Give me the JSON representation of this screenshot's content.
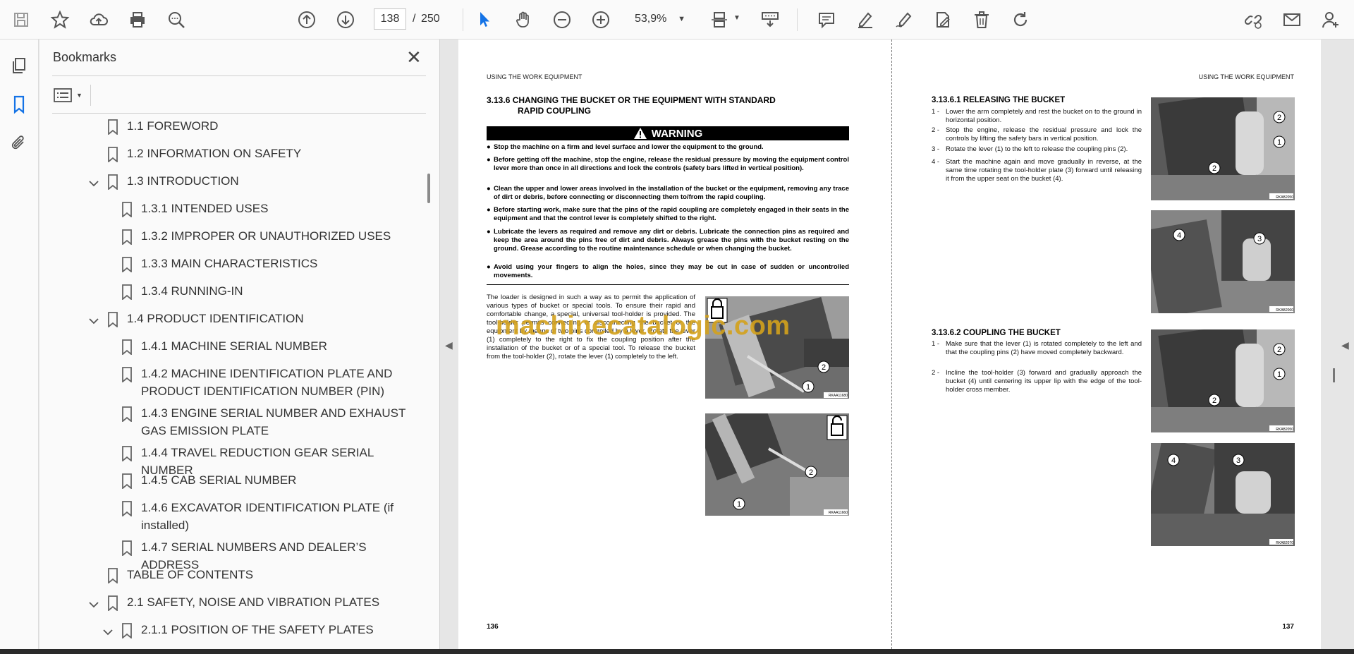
{
  "toolbar": {
    "current_page": "138",
    "page_separator": "/",
    "total_pages": "250",
    "zoom": "53,9%"
  },
  "bookmarks": {
    "title": "Bookmarks",
    "items": [
      {
        "label": "1.1 FOREWORD",
        "level": 0,
        "toggle": "none"
      },
      {
        "label": "1.2 INFORMATION ON SAFETY",
        "level": 0,
        "toggle": "none"
      },
      {
        "label": "1.3 INTRODUCTION",
        "level": 0,
        "toggle": "open"
      },
      {
        "label": "1.3.1 INTENDED USES",
        "level": 1,
        "toggle": "none"
      },
      {
        "label": "1.3.2 IMPROPER OR UNAUTHORIZED USES",
        "level": 1,
        "toggle": "none"
      },
      {
        "label": "1.3.3 MAIN CHARACTERISTICS",
        "level": 1,
        "toggle": "none"
      },
      {
        "label": "1.3.4 RUNNING-IN",
        "level": 1,
        "toggle": "none"
      },
      {
        "label": "1.4 PRODUCT IDENTIFICATION",
        "level": 0,
        "toggle": "open"
      },
      {
        "label": "1.4.1 MACHINE SERIAL NUMBER",
        "level": 1,
        "toggle": "none"
      },
      {
        "label": "1.4.2 MACHINE IDENTIFICATION PLATE AND PRODUCT IDENTIFICATION NUMBER (PIN)",
        "level": 1,
        "toggle": "none"
      },
      {
        "label": "1.4.3 ENGINE SERIAL NUMBER AND EXHAUST GAS EMISSION PLATE",
        "level": 1,
        "toggle": "none"
      },
      {
        "label": "1.4.4 TRAVEL REDUCTION GEAR SERIAL NUMBER",
        "level": 1,
        "toggle": "none"
      },
      {
        "label": "1.4.5 CAB SERIAL NUMBER",
        "level": 1,
        "toggle": "none"
      },
      {
        "label": "1.4.6 EXCAVATOR IDENTIFICATION PLATE (if installed)",
        "level": 1,
        "toggle": "none"
      },
      {
        "label": "1.4.7 SERIAL NUMBERS AND DEALER’S ADDRESS",
        "level": 1,
        "toggle": "none"
      },
      {
        "label": "TABLE OF CONTENTS",
        "level": 0,
        "toggle": "none"
      },
      {
        "label": "2.1 SAFETY, NOISE AND VIBRATION PLATES",
        "level": 0,
        "toggle": "open"
      },
      {
        "label": "2.1.1 POSITION OF THE SAFETY PLATES",
        "level": 1,
        "toggle": "open"
      }
    ]
  },
  "left_page": {
    "header": "USING THE WORK EQUIPMENT",
    "section_title_1": "3.13.6 CHANGING THE BUCKET OR THE EQUIPMENT WITH STANDARD",
    "section_title_2": "RAPID COUPLING",
    "warning_label": "WARNING",
    "warnings": [
      "Stop the machine on a firm and level surface and lower the equipment to the ground.",
      "Before getting off the machine, stop the engine, release the residual pressure by moving the equipment control lever more than once in all directions and lock the controls (safety bars lifted in vertical position).",
      "Clean the upper and lower areas involved in the installation of the bucket or the equipment, removing any trace of dirt or debris, before connecting or disconnecting them to/from the rapid coupling.",
      "Before starting work, make sure that the pins of the rapid coupling are completely engaged in their seats in the equipment and that the control lever is completely shifted to the right.",
      "Lubricate the levers as  required and remove any dirt or debris. Lubricate the connection pins as required and keep the area around the pins free of dirt and debris. Always grease the pins with the bucket resting on the ground. Grease according to the routine maintenance schedule or when changing the bucket.",
      "Avoid using your fingers to align the holes, since they may be cut in case of sudden or uncontrolled movements."
    ],
    "body_text": "The loader is designed in such a way as to permit the application of various types of bucket or special tools. To ensure their rapid and comfortable change, a special, universal tool-holder is provided. The tool-holder permits connecting or disconnecting the bucket or the equipment by means of two pins controlled by a lever. Rotate the lever (1) completely to the right to fix the coupling position after the installation of the bucket or of a special tool. To release the bucket from the tool-holder (2), rotate the lever (1) completely to the left.",
    "photo1_code": "RKAA11680",
    "photo2_code": "RKAA11660",
    "page_number": "136"
  },
  "right_page": {
    "header": "USING THE WORK EQUIPMENT",
    "sub1_title": "3.13.6.1  RELEASING THE BUCKET",
    "sub1_steps": [
      {
        "n": "1 -",
        "text": "Lower the arm completely and rest the bucket on to the ground in horizontal position."
      },
      {
        "n": "2 -",
        "text": "Stop the engine, release the residual pressure and lock the controls by lifting the safety bars in vertical position."
      },
      {
        "n": "3 -",
        "text": "Rotate the lever (1) to the left to release the coupling pins (2)."
      },
      {
        "n": "4 -",
        "text": "Start the machine again and move gradually in reverse, at the same time rotating the tool-holder plate (3) forward until releasing it from the upper seat on the bucket (4)."
      }
    ],
    "sub2_title": "3.13.6.2  COUPLING THE BUCKET",
    "sub2_steps": [
      {
        "n": "1 -",
        "text": "Make sure that the lever (1) is rotated completely to the left and that the coupling pins (2) have moved completely backward."
      },
      {
        "n": "2 -",
        "text": "Incline the tool-holder (3) forward and gradually approach the bucket (4) until centering its upper lip with the edge of the tool-holder cross member."
      }
    ],
    "photo_codes": [
      "RKAB2050",
      "RKAB2060",
      "RKAB2050",
      "RKAB2070"
    ],
    "page_number": "137"
  },
  "watermark": "machinecatalogic.com",
  "colors": {
    "accent_blue": "#1473e6",
    "watermark": "#d4a21c"
  }
}
